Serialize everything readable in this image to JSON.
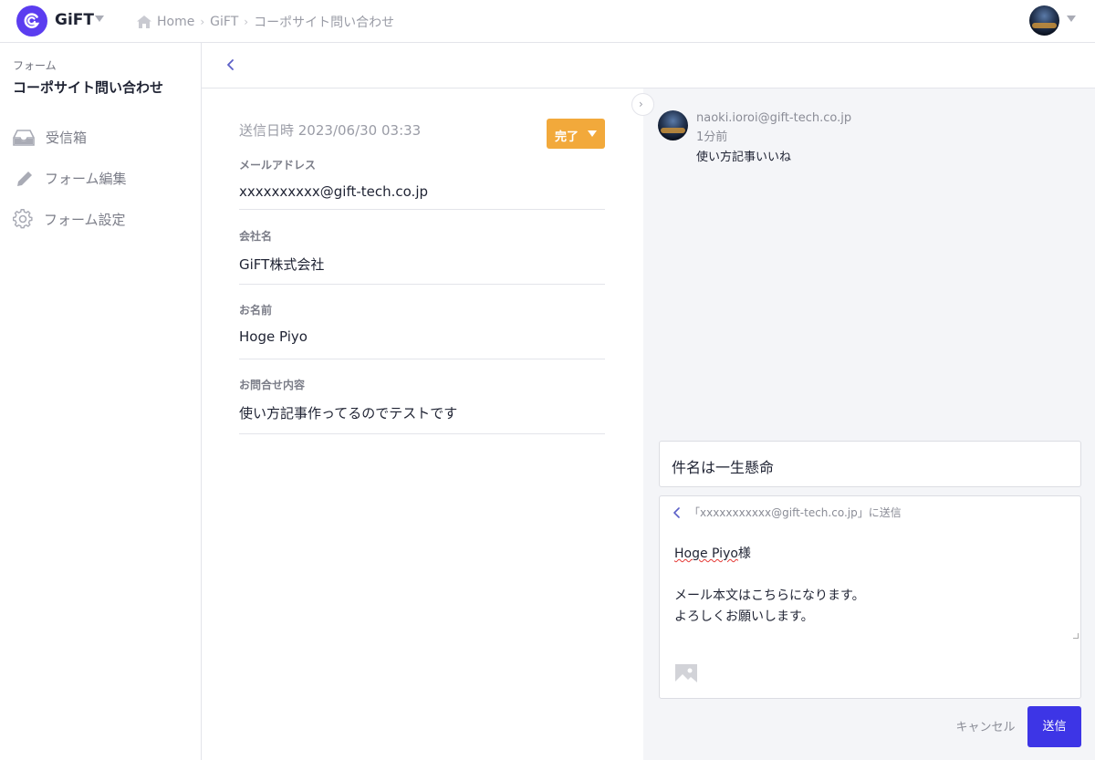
{
  "header": {
    "brand": "GiFT",
    "breadcrumbs": [
      "Home",
      "GiFT",
      "コーポサイト問い合わせ"
    ]
  },
  "sidebar": {
    "caption": "フォーム",
    "title": "コーポサイト問い合わせ",
    "items": [
      {
        "label": "受信箱",
        "icon": "inbox-icon"
      },
      {
        "label": "フォーム編集",
        "icon": "pencil-icon"
      },
      {
        "label": "フォーム設定",
        "icon": "gear-icon"
      }
    ]
  },
  "detail": {
    "sent_at": "送信日時 2023/06/30  03:33",
    "status": "完了",
    "fields": [
      {
        "label": "メールアドレス",
        "value": "xxxxxxxxxx@gift-tech.co.jp"
      },
      {
        "label": "会社名",
        "value": "GiFT株式会社"
      },
      {
        "label": "お名前",
        "value": "Hoge Piyo"
      },
      {
        "label": "お問合せ内容",
        "value": "使い方記事作ってるのでテストです"
      }
    ]
  },
  "comment": {
    "author": "naoki.ioroi@gift-tech.co.jp",
    "time": "1分前",
    "body": "使い方記事いいね"
  },
  "compose": {
    "subject": "件名は一生懸命",
    "to": "「xxxxxxxxxxx@gift-tech.co.jp」に送信",
    "greeting_name": "Hoge Piyo",
    "greeting_suffix": "様",
    "body_line1": "メール本文はこちらになります。",
    "body_line2": "よろしくお願いします。",
    "cancel": "キャンセル",
    "send": "送信"
  },
  "colors": {
    "brand": "#5b3df0",
    "status": "#f2a93b",
    "send": "#3d35e6"
  }
}
